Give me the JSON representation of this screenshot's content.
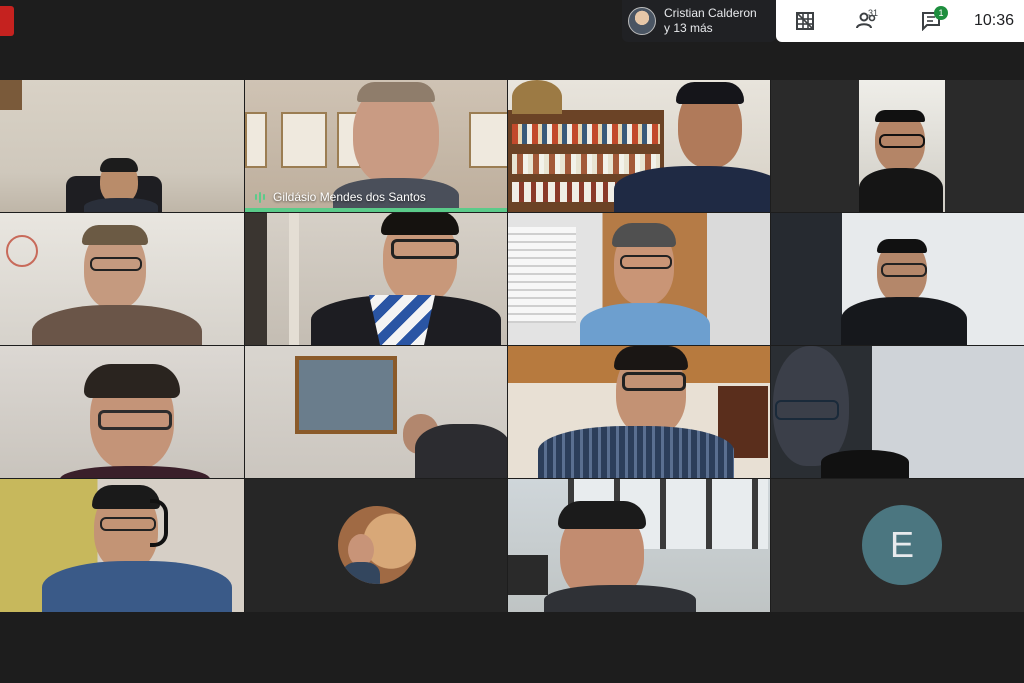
{
  "topbar": {
    "presenter_line1": "Cristian Calderon",
    "presenter_line2": "y 13 más",
    "layout_icon": "grid-layout-icon",
    "people_count": "31",
    "chat_count": "1",
    "clock": "10:36",
    "accent": "#1e8e3e",
    "record_color": "#c5221f"
  },
  "tiles": [
    {
      "name": "",
      "speaking": false
    },
    {
      "name": "Gildásio Mendes dos Santos",
      "speaking": true
    },
    {
      "name": "",
      "speaking": false
    },
    {
      "name": "",
      "speaking": false
    },
    {
      "name": "",
      "speaking": false
    },
    {
      "name": "",
      "speaking": false
    },
    {
      "name": "",
      "speaking": false
    },
    {
      "name": "",
      "speaking": false
    },
    {
      "name": "",
      "speaking": false
    },
    {
      "name": "",
      "speaking": false
    },
    {
      "name": "",
      "speaking": false
    },
    {
      "name": "",
      "speaking": false
    },
    {
      "name": "",
      "speaking": false
    },
    {
      "name": "",
      "speaking": false
    },
    {
      "name": "",
      "speaking": false
    },
    {
      "name": "",
      "speaking": false,
      "initial": "E"
    }
  ],
  "speaker_label": "Gildásio Mendes dos Santos",
  "avatar_initial": "E"
}
